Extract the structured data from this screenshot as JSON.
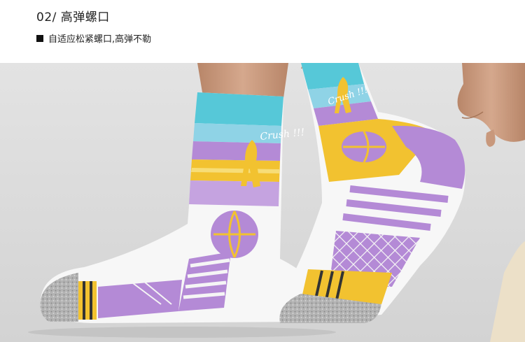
{
  "section": {
    "title": "02/ 高弹螺口",
    "bullet_icon": "square-bullet-icon",
    "subtitle": "自适应松紧螺口,高弹不勒"
  },
  "photo": {
    "sock_text": "Crush !!!",
    "colors": {
      "background": "#dddddd",
      "cuff_blue": "#56c8d8",
      "purple": "#b48ad6",
      "yellow": "#f2c230",
      "white": "#f7f7f7",
      "grey_toe": "#a8a8a8",
      "skin": "#c99a7e"
    }
  }
}
